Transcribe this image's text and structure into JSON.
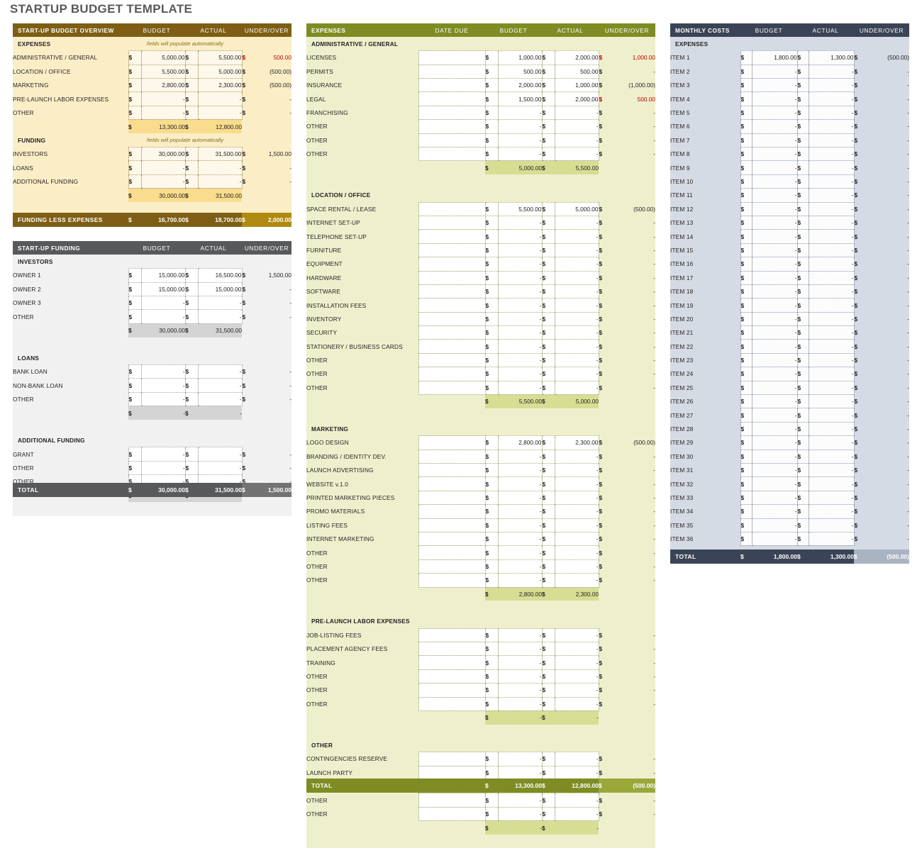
{
  "page": {
    "title": "STARTUP BUDGET TEMPLATE"
  },
  "colors": {
    "overview_header": "#7d5e14",
    "overview_bg": "#fbeec7",
    "overview_subtotal": "#f9dc8d",
    "overview_total_accent": "#b08a10",
    "funding_header": "#58595b",
    "funding_bg": "#f1f1f1",
    "funding_subtotal": "#d4d4d4",
    "expenses_header": "#7f8c23",
    "expenses_bg": "#eef0cd",
    "expenses_subtotal": "#d7de94",
    "monthly_header": "#3b4456",
    "monthly_bg": "#d5dbe4",
    "negative_text": "#c00000"
  },
  "columns": {
    "budget": "BUDGET",
    "actual": "ACTUAL",
    "under_over": "UNDER/OVER",
    "date_due": "DATE DUE",
    "currency": "$",
    "dash": "-"
  },
  "overview": {
    "header": {
      "label": "START-UP BUDGET OVERVIEW",
      "budget": "BUDGET",
      "actual": "ACTUAL",
      "under_over": "UNDER/OVER"
    },
    "expenses_section": {
      "label": "EXPENSES",
      "note": "fields will populate automatically"
    },
    "expense_rows": [
      {
        "label": "ADMINISTRATIVE / GENERAL",
        "budget": "5,000.00",
        "actual": "5,500.00",
        "under_over": "500.00",
        "over": true
      },
      {
        "label": "LOCATION / OFFICE",
        "budget": "5,500.00",
        "actual": "5,000.00",
        "under_over": "(500.00)",
        "over": false
      },
      {
        "label": "MARKETING",
        "budget": "2,800.00",
        "actual": "2,300.00",
        "under_over": "(500.00)",
        "over": false
      },
      {
        "label": "PRE-LAUNCH LABOR EXPENSES",
        "budget": "-",
        "actual": "-",
        "under_over": "-",
        "over": false
      },
      {
        "label": "OTHER",
        "budget": "-",
        "actual": "-",
        "under_over": "-",
        "over": false
      }
    ],
    "expenses_subtotal": {
      "budget": "13,300.00",
      "actual": "12,800.00"
    },
    "funding_section": {
      "label": "FUNDING",
      "note": "fields will populate automatically"
    },
    "funding_rows": [
      {
        "label": "INVESTORS",
        "budget": "30,000.00",
        "actual": "31,500.00",
        "under_over": "1,500.00",
        "over": false
      },
      {
        "label": "LOANS",
        "budget": "-",
        "actual": "-",
        "under_over": "-",
        "over": false
      },
      {
        "label": "ADDITIONAL FUNDING",
        "budget": "-",
        "actual": "-",
        "under_over": "-",
        "over": false
      }
    ],
    "funding_subtotal": {
      "budget": "30,000.00",
      "actual": "31,500.00"
    },
    "funding_less_expenses": {
      "label": "FUNDING LESS EXPENSES",
      "budget": "16,700.00",
      "actual": "18,700.00",
      "under_over": "2,000.00"
    }
  },
  "startup_funding": {
    "header": {
      "label": "START-UP FUNDING",
      "budget": "BUDGET",
      "actual": "ACTUAL",
      "under_over": "UNDER/OVER"
    },
    "sections": [
      {
        "title": "INVESTORS",
        "rows": [
          {
            "label": "OWNER 1",
            "budget": "15,000.00",
            "actual": "16,500.00",
            "under_over": "1,500.00"
          },
          {
            "label": "OWNER 2",
            "budget": "15,000.00",
            "actual": "15,000.00",
            "under_over": "-"
          },
          {
            "label": "OWNER 3",
            "budget": "-",
            "actual": "-",
            "under_over": "-"
          },
          {
            "label": "OTHER",
            "budget": "-",
            "actual": "-",
            "under_over": "-"
          }
        ],
        "subtotal": {
          "budget": "30,000.00",
          "actual": "31,500.00"
        }
      },
      {
        "title": "LOANS",
        "rows": [
          {
            "label": "BANK LOAN",
            "budget": "-",
            "actual": "-",
            "under_over": "-"
          },
          {
            "label": "NON-BANK LOAN",
            "budget": "-",
            "actual": "-",
            "under_over": "-"
          },
          {
            "label": "OTHER",
            "budget": "-",
            "actual": "-",
            "under_over": "-"
          }
        ],
        "subtotal": {
          "budget": "-",
          "actual": "-"
        }
      },
      {
        "title": "ADDITIONAL FUNDING",
        "rows": [
          {
            "label": "GRANT",
            "budget": "-",
            "actual": "-",
            "under_over": "-"
          },
          {
            "label": "OTHER",
            "budget": "-",
            "actual": "-",
            "under_over": "-"
          },
          {
            "label": "OTHER",
            "budget": "-",
            "actual": "-",
            "under_over": "-"
          }
        ],
        "subtotal": {
          "budget": "-",
          "actual": "-"
        }
      }
    ],
    "total": {
      "label": "TOTAL",
      "budget": "30,000.00",
      "actual": "31,500.00",
      "under_over": "1,500.00"
    }
  },
  "expenses": {
    "header": {
      "label": "EXPENSES",
      "date_due": "DATE DUE",
      "budget": "BUDGET",
      "actual": "ACTUAL",
      "under_over": "UNDER/OVER"
    },
    "sections": [
      {
        "title": "ADMINISTRATIVE / GENERAL",
        "rows": [
          {
            "label": "LICENSES",
            "date_due": "",
            "budget": "1,000.00",
            "actual": "2,000.00",
            "under_over": "1,000.00",
            "over": true
          },
          {
            "label": "PERMITS",
            "date_due": "",
            "budget": "500.00",
            "actual": "500.00",
            "under_over": "-",
            "over": false
          },
          {
            "label": "INSURANCE",
            "date_due": "",
            "budget": "2,000.00",
            "actual": "1,000.00",
            "under_over": "(1,000.00)",
            "over": false
          },
          {
            "label": "LEGAL",
            "date_due": "",
            "budget": "1,500.00",
            "actual": "2,000.00",
            "under_over": "500.00",
            "over": true
          },
          {
            "label": "FRANCHISING",
            "date_due": "",
            "budget": "-",
            "actual": "-",
            "under_over": "-",
            "over": false
          },
          {
            "label": "OTHER",
            "date_due": "",
            "budget": "-",
            "actual": "-",
            "under_over": "-",
            "over": false
          },
          {
            "label": "OTHER",
            "date_due": "",
            "budget": "-",
            "actual": "-",
            "under_over": "-",
            "over": false
          },
          {
            "label": "OTHER",
            "date_due": "",
            "budget": "-",
            "actual": "-",
            "under_over": "-",
            "over": false
          }
        ],
        "subtotal": {
          "budget": "5,000.00",
          "actual": "5,500.00"
        }
      },
      {
        "title": "LOCATION / OFFICE",
        "rows": [
          {
            "label": "SPACE RENTAL / LEASE",
            "date_due": "",
            "budget": "5,500.00",
            "actual": "5,000.00",
            "under_over": "(500.00)",
            "over": false
          },
          {
            "label": "INTERNET SET-UP",
            "date_due": "",
            "budget": "-",
            "actual": "-",
            "under_over": "-",
            "over": false
          },
          {
            "label": "TELEPHONE SET-UP",
            "date_due": "",
            "budget": "-",
            "actual": "-",
            "under_over": "-",
            "over": false
          },
          {
            "label": "FURNITURE",
            "date_due": "",
            "budget": "-",
            "actual": "-",
            "under_over": "-",
            "over": false
          },
          {
            "label": "EQUIPMENT",
            "date_due": "",
            "budget": "-",
            "actual": "-",
            "under_over": "-",
            "over": false
          },
          {
            "label": "HARDWARE",
            "date_due": "",
            "budget": "-",
            "actual": "-",
            "under_over": "-",
            "over": false
          },
          {
            "label": "SOFTWARE",
            "date_due": "",
            "budget": "-",
            "actual": "-",
            "under_over": "-",
            "over": false
          },
          {
            "label": "INSTALLATION FEES",
            "date_due": "",
            "budget": "-",
            "actual": "-",
            "under_over": "-",
            "over": false
          },
          {
            "label": "INVENTORY",
            "date_due": "",
            "budget": "-",
            "actual": "-",
            "under_over": "-",
            "over": false
          },
          {
            "label": "SECURITY",
            "date_due": "",
            "budget": "-",
            "actual": "-",
            "under_over": "-",
            "over": false
          },
          {
            "label": "STATIONERY / BUSINESS CARDS",
            "date_due": "",
            "budget": "-",
            "actual": "-",
            "under_over": "-",
            "over": false
          },
          {
            "label": "OTHER",
            "date_due": "",
            "budget": "-",
            "actual": "-",
            "under_over": "-",
            "over": false
          },
          {
            "label": "OTHER",
            "date_due": "",
            "budget": "-",
            "actual": "-",
            "under_over": "-",
            "over": false
          },
          {
            "label": "OTHER",
            "date_due": "",
            "budget": "-",
            "actual": "-",
            "under_over": "-",
            "over": false
          }
        ],
        "subtotal": {
          "budget": "5,500.00",
          "actual": "5,000.00"
        }
      },
      {
        "title": "MARKETING",
        "rows": [
          {
            "label": "LOGO DESIGN",
            "date_due": "",
            "budget": "2,800.00",
            "actual": "2,300.00",
            "under_over": "(500.00)",
            "over": false
          },
          {
            "label": "BRANDING / IDENTITY DEV.",
            "date_due": "",
            "budget": "-",
            "actual": "-",
            "under_over": "-",
            "over": false
          },
          {
            "label": "LAUNCH ADVERTISING",
            "date_due": "",
            "budget": "-",
            "actual": "-",
            "under_over": "-",
            "over": false
          },
          {
            "label": "WEBSITE v.1.0",
            "date_due": "",
            "budget": "-",
            "actual": "-",
            "under_over": "-",
            "over": false
          },
          {
            "label": "PRINTED MARKETING PIECES",
            "date_due": "",
            "budget": "-",
            "actual": "-",
            "under_over": "-",
            "over": false
          },
          {
            "label": "PROMO MATERIALS",
            "date_due": "",
            "budget": "-",
            "actual": "-",
            "under_over": "-",
            "over": false
          },
          {
            "label": "LISTING FEES",
            "date_due": "",
            "budget": "-",
            "actual": "-",
            "under_over": "-",
            "over": false
          },
          {
            "label": "INTERNET MARKETING",
            "date_due": "",
            "budget": "-",
            "actual": "-",
            "under_over": "-",
            "over": false
          },
          {
            "label": "OTHER",
            "date_due": "",
            "budget": "-",
            "actual": "-",
            "under_over": "-",
            "over": false
          },
          {
            "label": "OTHER",
            "date_due": "",
            "budget": "-",
            "actual": "-",
            "under_over": "-",
            "over": false
          },
          {
            "label": "OTHER",
            "date_due": "",
            "budget": "-",
            "actual": "-",
            "under_over": "-",
            "over": false
          }
        ],
        "subtotal": {
          "budget": "2,800.00",
          "actual": "2,300.00"
        }
      },
      {
        "title": "PRE-LAUNCH LABOR EXPENSES",
        "rows": [
          {
            "label": "JOB-LISTING FEES",
            "date_due": "",
            "budget": "-",
            "actual": "-",
            "under_over": "-",
            "over": false
          },
          {
            "label": "PLACEMENT AGENCY FEES",
            "date_due": "",
            "budget": "-",
            "actual": "-",
            "under_over": "-",
            "over": false
          },
          {
            "label": "TRAINING",
            "date_due": "",
            "budget": "-",
            "actual": "-",
            "under_over": "-",
            "over": false
          },
          {
            "label": "OTHER",
            "date_due": "",
            "budget": "-",
            "actual": "-",
            "under_over": "-",
            "over": false
          },
          {
            "label": "OTHER",
            "date_due": "",
            "budget": "-",
            "actual": "-",
            "under_over": "-",
            "over": false
          },
          {
            "label": "OTHER",
            "date_due": "",
            "budget": "-",
            "actual": "-",
            "under_over": "-",
            "over": false
          }
        ],
        "subtotal": {
          "budget": "-",
          "actual": "-"
        }
      },
      {
        "title": "OTHER",
        "rows": [
          {
            "label": "CONTINGENCIES RESERVE",
            "date_due": "",
            "budget": "-",
            "actual": "-",
            "under_over": "-",
            "over": false
          },
          {
            "label": "LAUNCH PARTY",
            "date_due": "",
            "budget": "-",
            "actual": "-",
            "under_over": "-",
            "over": false
          },
          {
            "label": "OTHER",
            "date_due": "",
            "budget": "-",
            "actual": "-",
            "under_over": "-",
            "over": false
          },
          {
            "label": "OTHER",
            "date_due": "",
            "budget": "-",
            "actual": "-",
            "under_over": "-",
            "over": false
          },
          {
            "label": "OTHER",
            "date_due": "",
            "budget": "-",
            "actual": "-",
            "under_over": "-",
            "over": false
          }
        ],
        "subtotal": {
          "budget": "-",
          "actual": "-"
        }
      }
    ],
    "total": {
      "label": "TOTAL",
      "budget": "13,300.00",
      "actual": "12,800.00",
      "under_over": "(500.00)"
    }
  },
  "monthly_costs": {
    "header": {
      "label": "MONTHLY COSTS",
      "budget": "BUDGET",
      "actual": "ACTUAL",
      "under_over": "UNDER/OVER"
    },
    "section_title": "EXPENSES",
    "rows": [
      {
        "label": "ITEM 1",
        "budget": "1,800.00",
        "actual": "1,300.00",
        "under_over": "(500.00)"
      },
      {
        "label": "ITEM 2",
        "budget": "-",
        "actual": "-",
        "under_over": "-"
      },
      {
        "label": "ITEM 3",
        "budget": "-",
        "actual": "-",
        "under_over": "-"
      },
      {
        "label": "ITEM 4",
        "budget": "-",
        "actual": "-",
        "under_over": "-"
      },
      {
        "label": "ITEM 5",
        "budget": "-",
        "actual": "-",
        "under_over": "-"
      },
      {
        "label": "ITEM 6",
        "budget": "-",
        "actual": "-",
        "under_over": "-"
      },
      {
        "label": "ITEM 7",
        "budget": "-",
        "actual": "-",
        "under_over": "-"
      },
      {
        "label": "ITEM 8",
        "budget": "-",
        "actual": "-",
        "under_over": "-"
      },
      {
        "label": "ITEM 9",
        "budget": "-",
        "actual": "-",
        "under_over": "-"
      },
      {
        "label": "ITEM 10",
        "budget": "-",
        "actual": "-",
        "under_over": "-"
      },
      {
        "label": "ITEM 11",
        "budget": "-",
        "actual": "-",
        "under_over": "-"
      },
      {
        "label": "ITEM 12",
        "budget": "-",
        "actual": "-",
        "under_over": "-"
      },
      {
        "label": "ITEM 13",
        "budget": "-",
        "actual": "-",
        "under_over": "-"
      },
      {
        "label": "ITEM 14",
        "budget": "-",
        "actual": "-",
        "under_over": "-"
      },
      {
        "label": "ITEM 15",
        "budget": "-",
        "actual": "-",
        "under_over": "-"
      },
      {
        "label": "ITEM 16",
        "budget": "-",
        "actual": "-",
        "under_over": "-"
      },
      {
        "label": "ITEM 17",
        "budget": "-",
        "actual": "-",
        "under_over": "-"
      },
      {
        "label": "ITEM 18",
        "budget": "-",
        "actual": "-",
        "under_over": "-"
      },
      {
        "label": "ITEM 19",
        "budget": "-",
        "actual": "-",
        "under_over": "-"
      },
      {
        "label": "ITEM 20",
        "budget": "-",
        "actual": "-",
        "under_over": "-"
      },
      {
        "label": "ITEM 21",
        "budget": "-",
        "actual": "-",
        "under_over": "-"
      },
      {
        "label": "ITEM 22",
        "budget": "-",
        "actual": "-",
        "under_over": "-"
      },
      {
        "label": "ITEM 23",
        "budget": "-",
        "actual": "-",
        "under_over": "-"
      },
      {
        "label": "ITEM 24",
        "budget": "-",
        "actual": "-",
        "under_over": "-"
      },
      {
        "label": "ITEM 25",
        "budget": "-",
        "actual": "-",
        "under_over": "-"
      },
      {
        "label": "ITEM 26",
        "budget": "-",
        "actual": "-",
        "under_over": "-"
      },
      {
        "label": "ITEM 27",
        "budget": "-",
        "actual": "-",
        "under_over": "-"
      },
      {
        "label": "ITEM 28",
        "budget": "-",
        "actual": "-",
        "under_over": "-"
      },
      {
        "label": "ITEM 29",
        "budget": "-",
        "actual": "-",
        "under_over": "-"
      },
      {
        "label": "ITEM 30",
        "budget": "-",
        "actual": "-",
        "under_over": "-"
      },
      {
        "label": "ITEM 31",
        "budget": "-",
        "actual": "-",
        "under_over": "-"
      },
      {
        "label": "ITEM 32",
        "budget": "-",
        "actual": "-",
        "under_over": "-"
      },
      {
        "label": "ITEM 33",
        "budget": "-",
        "actual": "-",
        "under_over": "-"
      },
      {
        "label": "ITEM 34",
        "budget": "-",
        "actual": "-",
        "under_over": "-"
      },
      {
        "label": "ITEM 35",
        "budget": "-",
        "actual": "-",
        "under_over": "-"
      },
      {
        "label": "ITEM 36",
        "budget": "-",
        "actual": "-",
        "under_over": "-"
      }
    ],
    "total": {
      "label": "TOTAL",
      "budget": "1,800.00",
      "actual": "1,300.00",
      "under_over": "(500.00)"
    }
  }
}
